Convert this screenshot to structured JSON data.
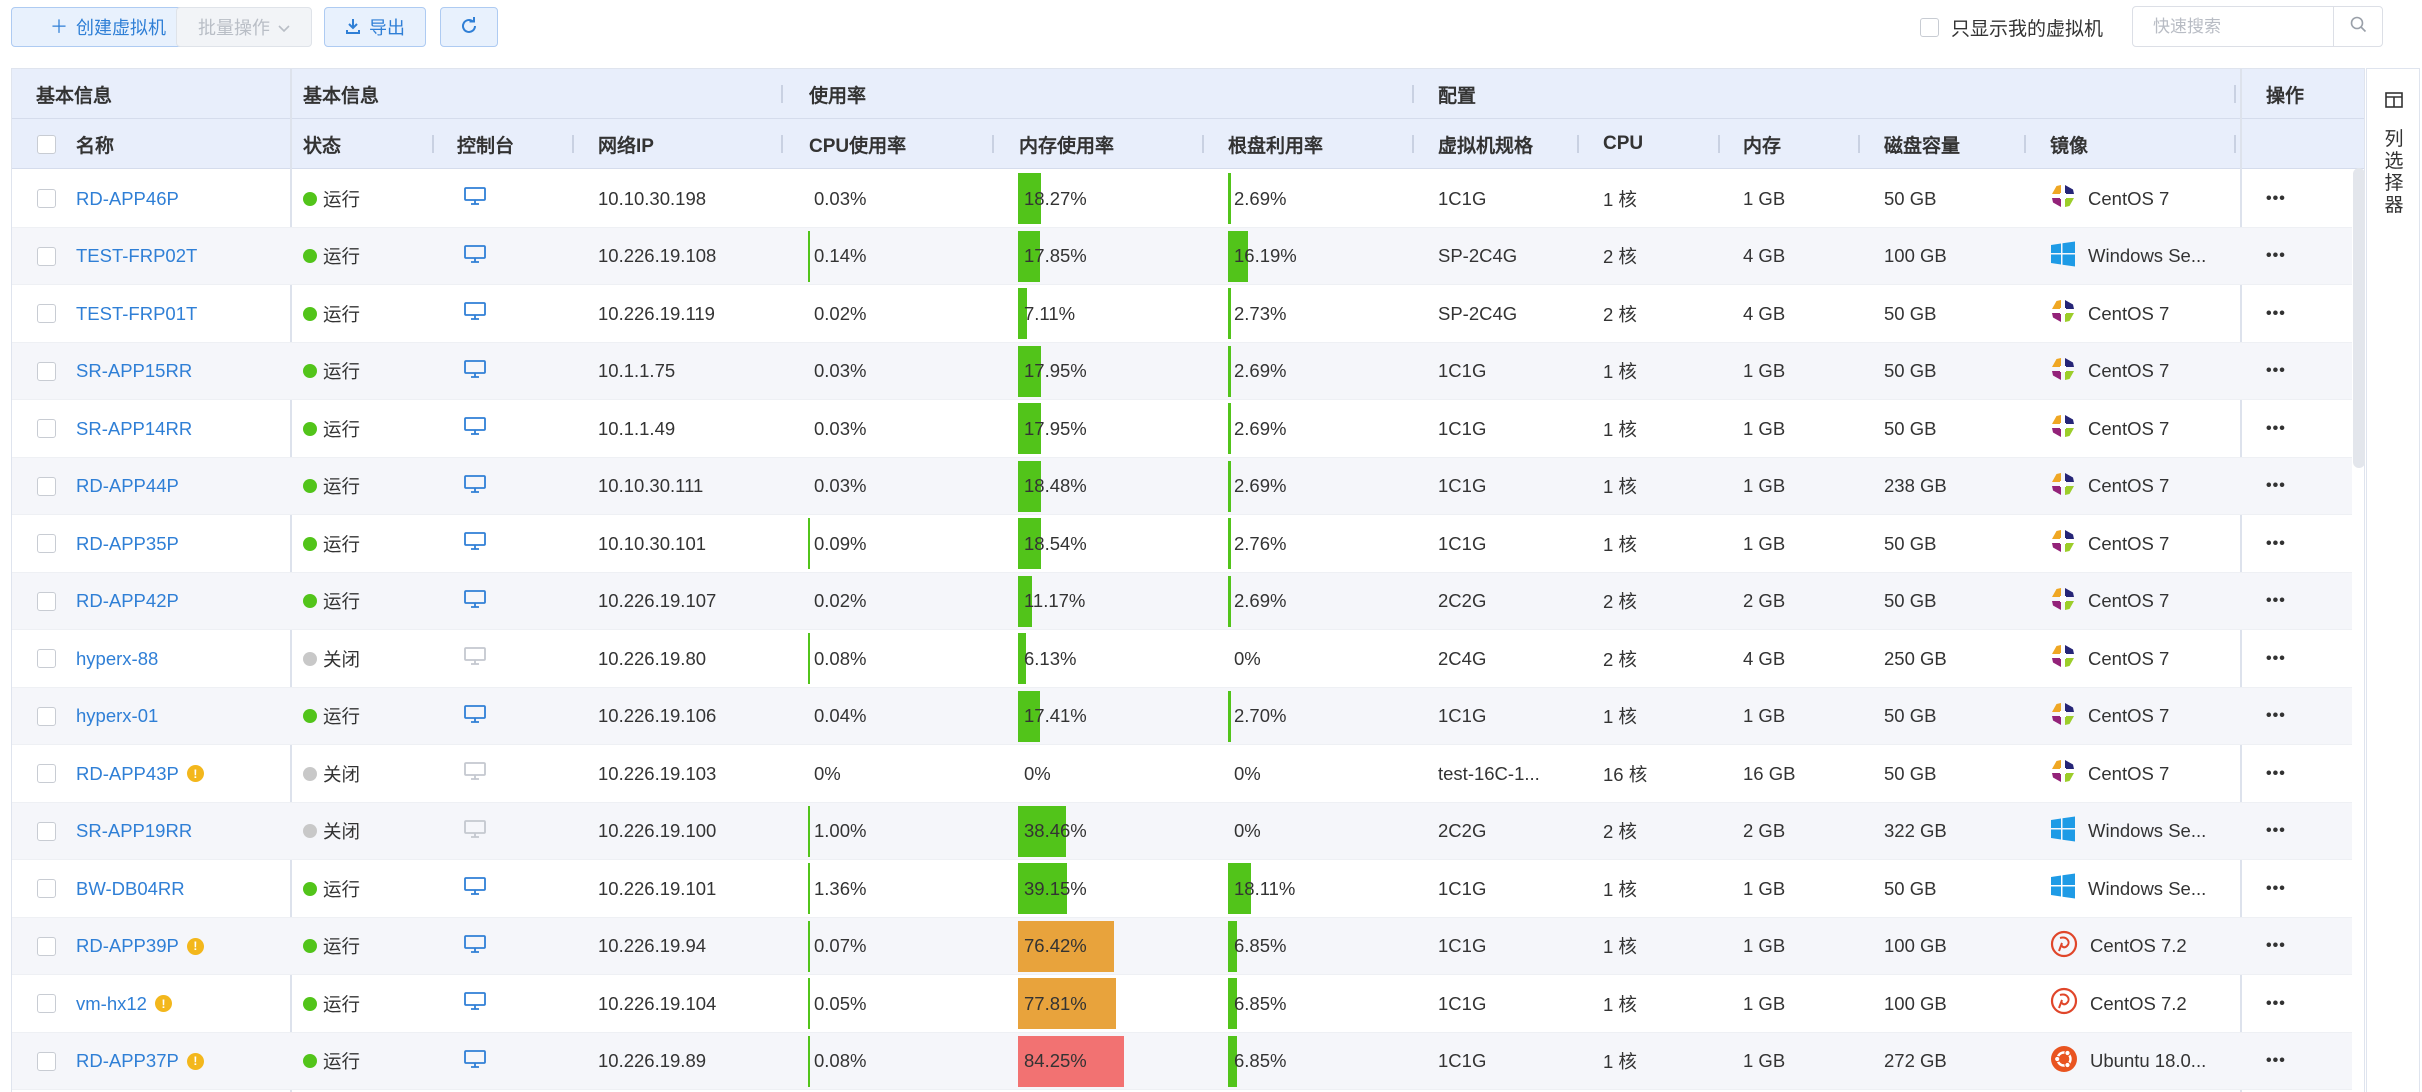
{
  "toolbar": {
    "create_label": "创建虚拟机",
    "batch_label": "批量操作",
    "export_label": "导出",
    "only_mine_label": "只显示我的虚拟机",
    "search_placeholder": "快速搜索"
  },
  "table": {
    "group_headers": [
      "基本信息",
      "基本信息",
      "使用率",
      "配置",
      "操作"
    ],
    "columns": [
      "名称",
      "状态",
      "控制台",
      "网络IP",
      "CPU使用率",
      "内存使用率",
      "根盘利用率",
      "虚拟机规格",
      "CPU",
      "内存",
      "磁盘容量",
      "镜像"
    ],
    "rows": [
      {
        "name": "RD-APP46P",
        "warn": false,
        "status": "运行",
        "running": true,
        "ip": "10.10.30.198",
        "cpu": "0.03%",
        "cpu_v": 0.03,
        "mem": "18.27%",
        "mem_v": 18.27,
        "disk": "2.69%",
        "disk_v": 2.69,
        "spec": "1C1G",
        "cpu_cores": "1 核",
        "memory": "1 GB",
        "disk_cap": "50 GB",
        "os": "centos",
        "image": "CentOS 7"
      },
      {
        "name": "TEST-FRP02T",
        "warn": false,
        "status": "运行",
        "running": true,
        "ip": "10.226.19.108",
        "cpu": "0.14%",
        "cpu_v": 0.14,
        "mem": "17.85%",
        "mem_v": 17.85,
        "disk": "16.19%",
        "disk_v": 16.19,
        "spec": "SP-2C4G",
        "cpu_cores": "2 核",
        "memory": "4 GB",
        "disk_cap": "100 GB",
        "os": "windows",
        "image": "Windows Se..."
      },
      {
        "name": "TEST-FRP01T",
        "warn": false,
        "status": "运行",
        "running": true,
        "ip": "10.226.19.119",
        "cpu": "0.02%",
        "cpu_v": 0.02,
        "mem": "7.11%",
        "mem_v": 7.11,
        "disk": "2.73%",
        "disk_v": 2.73,
        "spec": "SP-2C4G",
        "cpu_cores": "2 核",
        "memory": "4 GB",
        "disk_cap": "50 GB",
        "os": "centos",
        "image": "CentOS 7"
      },
      {
        "name": "SR-APP15RR",
        "warn": false,
        "status": "运行",
        "running": true,
        "ip": "10.1.1.75",
        "cpu": "0.03%",
        "cpu_v": 0.03,
        "mem": "17.95%",
        "mem_v": 17.95,
        "disk": "2.69%",
        "disk_v": 2.69,
        "spec": "1C1G",
        "cpu_cores": "1 核",
        "memory": "1 GB",
        "disk_cap": "50 GB",
        "os": "centos",
        "image": "CentOS 7"
      },
      {
        "name": "SR-APP14RR",
        "warn": false,
        "status": "运行",
        "running": true,
        "ip": "10.1.1.49",
        "cpu": "0.03%",
        "cpu_v": 0.03,
        "mem": "17.95%",
        "mem_v": 17.95,
        "disk": "2.69%",
        "disk_v": 2.69,
        "spec": "1C1G",
        "cpu_cores": "1 核",
        "memory": "1 GB",
        "disk_cap": "50 GB",
        "os": "centos",
        "image": "CentOS 7"
      },
      {
        "name": "RD-APP44P",
        "warn": false,
        "status": "运行",
        "running": true,
        "ip": "10.10.30.111",
        "cpu": "0.03%",
        "cpu_v": 0.03,
        "mem": "18.48%",
        "mem_v": 18.48,
        "disk": "2.69%",
        "disk_v": 2.69,
        "spec": "1C1G",
        "cpu_cores": "1 核",
        "memory": "1 GB",
        "disk_cap": "238 GB",
        "os": "centos",
        "image": "CentOS 7"
      },
      {
        "name": "RD-APP35P",
        "warn": false,
        "status": "运行",
        "running": true,
        "ip": "10.10.30.101",
        "cpu": "0.09%",
        "cpu_v": 0.09,
        "mem": "18.54%",
        "mem_v": 18.54,
        "disk": "2.76%",
        "disk_v": 2.76,
        "spec": "1C1G",
        "cpu_cores": "1 核",
        "memory": "1 GB",
        "disk_cap": "50 GB",
        "os": "centos",
        "image": "CentOS 7"
      },
      {
        "name": "RD-APP42P",
        "warn": false,
        "status": "运行",
        "running": true,
        "ip": "10.226.19.107",
        "cpu": "0.02%",
        "cpu_v": 0.02,
        "mem": "11.17%",
        "mem_v": 11.17,
        "disk": "2.69%",
        "disk_v": 2.69,
        "spec": "2C2G",
        "cpu_cores": "2 核",
        "memory": "2 GB",
        "disk_cap": "50 GB",
        "os": "centos",
        "image": "CentOS 7"
      },
      {
        "name": "hyperx-88",
        "warn": false,
        "status": "关闭",
        "running": false,
        "ip": "10.226.19.80",
        "cpu": "0.08%",
        "cpu_v": 0.08,
        "mem": "6.13%",
        "mem_v": 6.13,
        "disk": "0%",
        "disk_v": 0,
        "spec": "2C4G",
        "cpu_cores": "2 核",
        "memory": "4 GB",
        "disk_cap": "250 GB",
        "os": "centos",
        "image": "CentOS 7"
      },
      {
        "name": "hyperx-01",
        "warn": false,
        "status": "运行",
        "running": true,
        "ip": "10.226.19.106",
        "cpu": "0.04%",
        "cpu_v": 0.04,
        "mem": "17.41%",
        "mem_v": 17.41,
        "disk": "2.70%",
        "disk_v": 2.7,
        "spec": "1C1G",
        "cpu_cores": "1 核",
        "memory": "1 GB",
        "disk_cap": "50 GB",
        "os": "centos",
        "image": "CentOS 7"
      },
      {
        "name": "RD-APP43P",
        "warn": true,
        "status": "关闭",
        "running": false,
        "ip": "10.226.19.103",
        "cpu": "0%",
        "cpu_v": 0,
        "mem": "0%",
        "mem_v": 0,
        "disk": "0%",
        "disk_v": 0,
        "spec": "test-16C-1...",
        "cpu_cores": "16 核",
        "memory": "16 GB",
        "disk_cap": "50 GB",
        "os": "centos",
        "image": "CentOS 7"
      },
      {
        "name": "SR-APP19RR",
        "warn": false,
        "status": "关闭",
        "running": false,
        "ip": "10.226.19.100",
        "cpu": "1.00%",
        "cpu_v": 1.0,
        "mem": "38.46%",
        "mem_v": 38.46,
        "disk": "0%",
        "disk_v": 0,
        "spec": "2C2G",
        "cpu_cores": "2 核",
        "memory": "2 GB",
        "disk_cap": "322 GB",
        "os": "windows",
        "image": "Windows Se..."
      },
      {
        "name": "BW-DB04RR",
        "warn": false,
        "status": "运行",
        "running": true,
        "ip": "10.226.19.101",
        "cpu": "1.36%",
        "cpu_v": 1.36,
        "mem": "39.15%",
        "mem_v": 39.15,
        "disk": "18.11%",
        "disk_v": 18.11,
        "spec": "1C1G",
        "cpu_cores": "1 核",
        "memory": "1 GB",
        "disk_cap": "50 GB",
        "os": "windows",
        "image": "Windows Se..."
      },
      {
        "name": "RD-APP39P",
        "warn": true,
        "status": "运行",
        "running": true,
        "ip": "10.226.19.94",
        "cpu": "0.07%",
        "cpu_v": 0.07,
        "mem": "76.42%",
        "mem_v": 76.42,
        "disk": "6.85%",
        "disk_v": 6.85,
        "spec": "1C1G",
        "cpu_cores": "1 核",
        "memory": "1 GB",
        "disk_cap": "100 GB",
        "os": "debian",
        "image": "CentOS 7.2"
      },
      {
        "name": "vm-hx12",
        "warn": true,
        "status": "运行",
        "running": true,
        "ip": "10.226.19.104",
        "cpu": "0.05%",
        "cpu_v": 0.05,
        "mem": "77.81%",
        "mem_v": 77.81,
        "disk": "6.85%",
        "disk_v": 6.85,
        "spec": "1C1G",
        "cpu_cores": "1 核",
        "memory": "1 GB",
        "disk_cap": "100 GB",
        "os": "debian",
        "image": "CentOS 7.2"
      },
      {
        "name": "RD-APP37P",
        "warn": true,
        "status": "运行",
        "running": true,
        "ip": "10.226.19.89",
        "cpu": "0.08%",
        "cpu_v": 0.08,
        "mem": "84.25%",
        "mem_v": 84.25,
        "disk": "6.85%",
        "disk_v": 6.85,
        "spec": "1C1G",
        "cpu_cores": "1 核",
        "memory": "1 GB",
        "disk_cap": "272 GB",
        "os": "ubuntu",
        "image": "Ubuntu 18.0..."
      }
    ]
  },
  "column_chooser_label": "列选择器",
  "colors": {
    "link": "#2f7fd6",
    "running": "#52c41a",
    "stopped": "#c8c8c8",
    "bar_green": "#52c41a",
    "bar_orange": "#e8a33c",
    "bar_red": "#f27272",
    "warn": "#f3b71c"
  }
}
